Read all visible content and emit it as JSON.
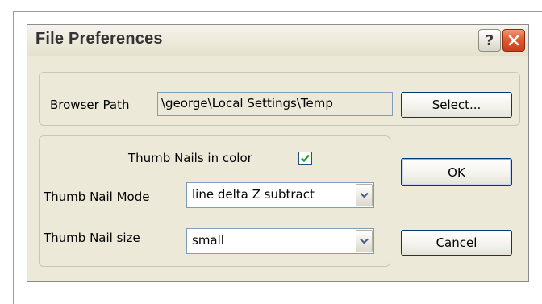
{
  "window": {
    "title": "File Preferences",
    "help_glyph": "?",
    "help_icon": "question-icon",
    "close_icon": "close-x-icon"
  },
  "browser_path": {
    "label": "Browser Path",
    "value": "\\george\\Local Settings\\Temp",
    "select_button": "Select..."
  },
  "thumbnails": {
    "color_label": "Thumb Nails in color",
    "color_checked": true,
    "mode_label": "Thumb Nail Mode",
    "mode_value": "line delta Z subtract",
    "size_label": "Thumb Nail size",
    "size_value": "small"
  },
  "buttons": {
    "ok": "OK",
    "cancel": "Cancel"
  },
  "colors": {
    "dialog_bg": "#ece9d8",
    "close_button": "#e25a30",
    "checkmark": "#21a121",
    "button_border": "#003c74"
  }
}
